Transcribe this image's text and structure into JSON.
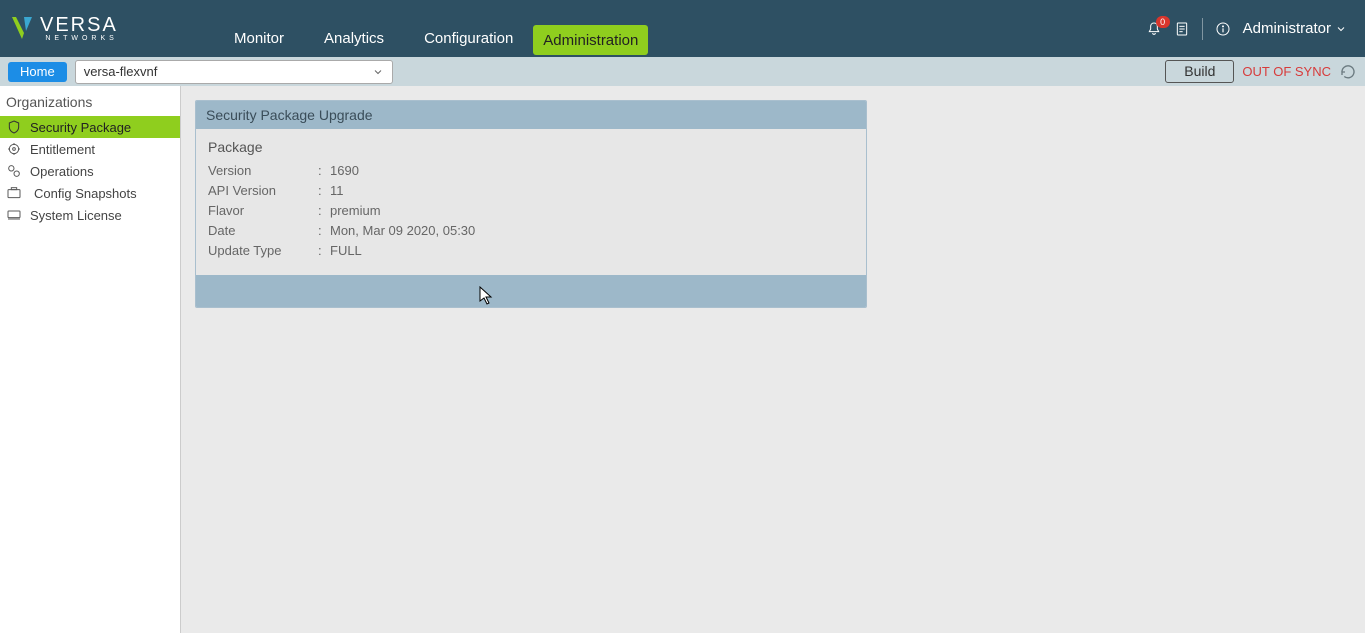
{
  "brand": {
    "name": "VERSA",
    "subname": "NETWORKS"
  },
  "nav": {
    "monitor": "Monitor",
    "analytics": "Analytics",
    "configuration": "Configuration",
    "administration": "Administration"
  },
  "header": {
    "notification_count": "0",
    "user_label": "Administrator"
  },
  "toolbar": {
    "home_label": "Home",
    "appliance_selected": "versa-flexvnf",
    "build_label": "Build",
    "sync_status": "OUT OF SYNC"
  },
  "sidebar": {
    "heading": "Organizations",
    "items": [
      {
        "label": "Security Package",
        "icon": "security-package-icon"
      },
      {
        "label": "Entitlement",
        "icon": "entitlement-icon"
      },
      {
        "label": "Operations",
        "icon": "operations-icon"
      },
      {
        "label": "Config Snapshots",
        "icon": "config-snapshots-icon"
      },
      {
        "label": "System License",
        "icon": "system-license-icon"
      }
    ]
  },
  "panel": {
    "title": "Security Package Upgrade",
    "section": "Package",
    "rows": {
      "version_label": "Version",
      "version_value": "1690",
      "api_version_label": "API Version",
      "api_version_value": "11",
      "flavor_label": "Flavor",
      "flavor_value": "premium",
      "date_label": "Date",
      "date_value": "Mon, Mar 09 2020, 05:30",
      "update_type_label": "Update Type",
      "update_type_value": "FULL"
    }
  }
}
